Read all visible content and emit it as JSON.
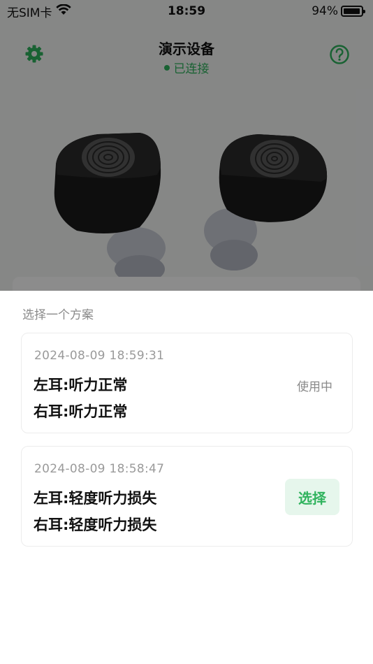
{
  "status_bar": {
    "carrier": "无SIM卡",
    "time": "18:59",
    "battery_percent": "94%",
    "battery_level": 0.94
  },
  "header": {
    "device_name": "演示设备",
    "connection_status": "已连接",
    "settings_icon": "gear-icon",
    "help_icon": "question-circle-icon"
  },
  "colors": {
    "accent": "#2fb35d",
    "select_bg": "#e6f6ec"
  },
  "sheet": {
    "title": "选择一个方案",
    "plans": [
      {
        "date": "2024-08-09 18:59:31",
        "left_ear": "左耳:听力正常",
        "right_ear": "右耳:听力正常",
        "status": "使用中"
      },
      {
        "date": "2024-08-09 18:58:47",
        "left_ear": "左耳:轻度听力损失",
        "right_ear": "右耳:轻度听力损失",
        "action": "选择"
      }
    ]
  }
}
